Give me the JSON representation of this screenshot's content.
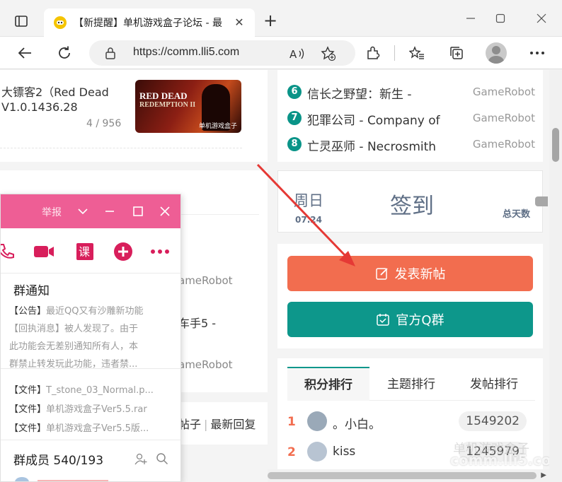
{
  "browser": {
    "tab_title": "【新提醒】单机游戏盒子论坛 - 最",
    "url": "https://comm.lli5.com",
    "new_tab_symbol": "+"
  },
  "left": {
    "post1": {
      "line1": "大镖客2（Red Dead",
      "line2": "V1.0.1436.28",
      "count": "4 / 956",
      "thumb_title_1": "RED DEAD",
      "thumb_title_2": "REDEMPTION II",
      "thumb_mark": "单机游戏盒子"
    },
    "mid": {
      "author1": "ameRobot",
      "title": "车手5 -",
      "author2": "ameRobot"
    },
    "bottom": {
      "text_a": "帖子",
      "text_b": "最新回复"
    }
  },
  "right": {
    "list": [
      {
        "num": "6",
        "title": "信长之野望：新生 -",
        "author": "GameRobot"
      },
      {
        "num": "7",
        "title": "犯罪公司 - Company of",
        "author": "GameRobot"
      },
      {
        "num": "8",
        "title": "亡灵巫师 - Necrosmith",
        "author": "GameRobot"
      }
    ],
    "signin": {
      "day": "周日",
      "date": "07.24",
      "button": "签到",
      "total": "总天数"
    },
    "actions": {
      "post_label": "发表新帖",
      "qq_label": "官方Q群",
      "post_color": "#f26d4f",
      "qq_color": "#0d978b"
    },
    "rank": {
      "tabs": [
        "积分排行",
        "主题排行",
        "发帖排行"
      ],
      "rows": [
        {
          "pos": "1",
          "name": "。小白。",
          "score": "1549202"
        },
        {
          "pos": "2",
          "name": "kiss",
          "score": "1245979"
        }
      ]
    },
    "watermark": "comm.lli5.com",
    "watermark_cn": "单机游戏盒子"
  },
  "qq": {
    "report": "举报",
    "header_color": "#ee5e95",
    "notice_title": "群通知",
    "notice_lines": [
      {
        "tag": "【公告】",
        "text": "最近QQ又有沙雕新功能"
      },
      {
        "tag": "",
        "text": "【回执消息】被人发现了。由于"
      },
      {
        "tag": "",
        "text": "此功能会无差别通知所有人，本"
      },
      {
        "tag": "",
        "text": "群禁止转发玩此功能，违者禁..."
      }
    ],
    "files": [
      {
        "tag": "【文件】",
        "text": "T_stone_03_Normal.p..."
      },
      {
        "tag": "【文件】",
        "text": "单机游戏盒子Ver5.5.rar"
      },
      {
        "tag": "【文件】",
        "text": "单机游戏盒子Ver5.5版..."
      }
    ],
    "members_title": "群成员 540/193"
  }
}
